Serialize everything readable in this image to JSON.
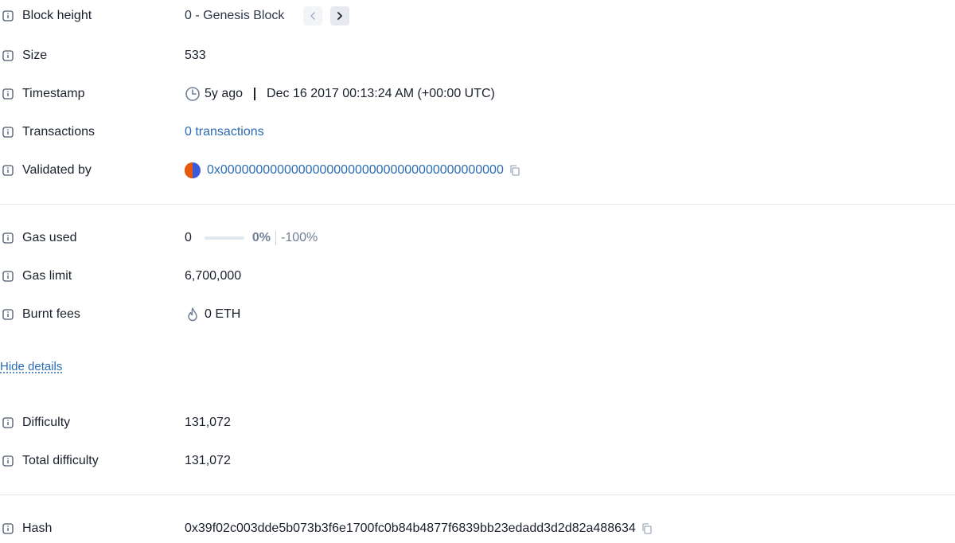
{
  "block": {
    "height": {
      "label": "Block height",
      "value": "0 - Genesis Block"
    },
    "size": {
      "label": "Size",
      "value": "533"
    },
    "timestamp": {
      "label": "Timestamp",
      "ago": "5y ago",
      "date": "Dec 16 2017 00:13:24 AM (+00:00 UTC)"
    },
    "transactions": {
      "label": "Transactions",
      "value": "0 transactions"
    },
    "validated_by": {
      "label": "Validated by",
      "address": "0x0000000000000000000000000000000000000000"
    }
  },
  "gas": {
    "used": {
      "label": "Gas used",
      "value": "0",
      "percent": "0%",
      "target": "-100%",
      "fill_fraction": 0
    },
    "limit": {
      "label": "Gas limit",
      "value": "6,700,000"
    },
    "burnt": {
      "label": "Burnt fees",
      "value": "0 ETH"
    }
  },
  "toggle": {
    "hide_details": "Hide details"
  },
  "details": {
    "difficulty": {
      "label": "Difficulty",
      "value": "131,072"
    },
    "total_difficulty": {
      "label": "Total difficulty",
      "value": "131,072"
    },
    "hash": {
      "label": "Hash",
      "value": "0x39f02c003dde5b073b3f6e1700fc0b84b4877f6839bb23edadd3d2d82a488634"
    }
  },
  "colors": {
    "link": "#2b6cb0",
    "text": "#1a202c",
    "muted": "#718096",
    "divider": "#e2e8f0",
    "avatar_left": "#e8590c",
    "avatar_right": "#3b5bdb"
  },
  "icons": {
    "info": "info-icon",
    "prev": "chevron-left-icon",
    "next": "chevron-right-icon",
    "clock": "clock-icon",
    "copy": "copy-icon",
    "flame": "flame-icon"
  }
}
